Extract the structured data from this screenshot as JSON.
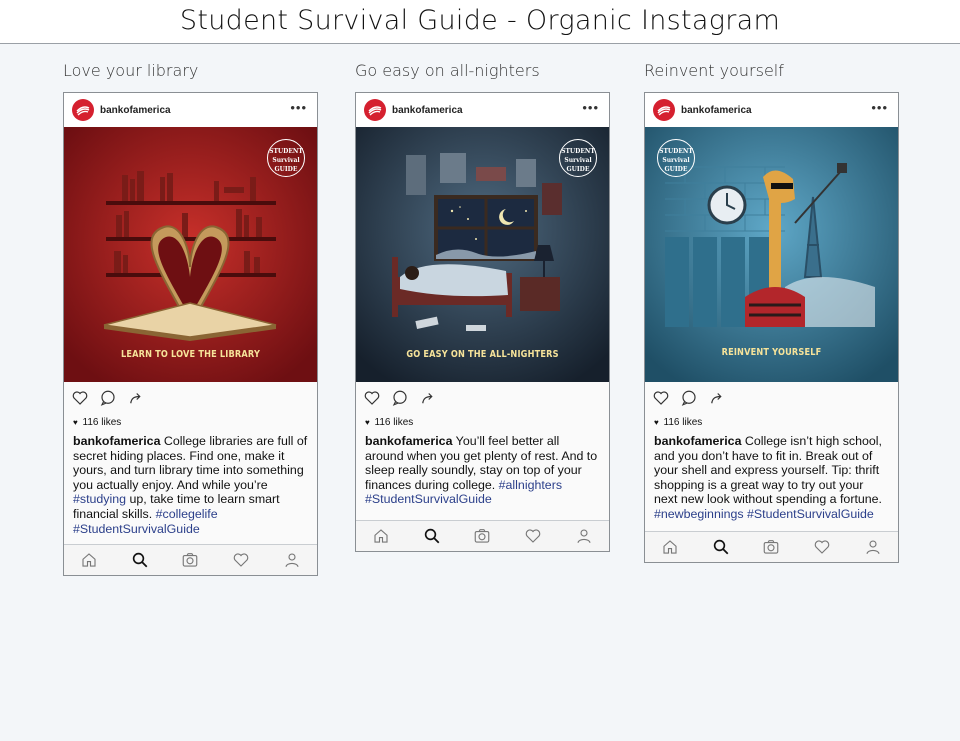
{
  "page": {
    "title": "Student Survival Guide - Organic Instagram"
  },
  "colors": {
    "brand_red": "#d5202f",
    "hashtag": "#2b3f8a",
    "banner_text": "#f6e39a"
  },
  "posts": [
    {
      "label": "Love your library",
      "username": "bankofamerica",
      "banner": "LEARN TO LOVE THE LIBRARY",
      "badge": "STUDENT Survival GUIDE",
      "likes": "116 likes",
      "caption_user": "bankofamerica",
      "caption_parts": [
        " College libraries are full of secret hiding places. Find one, make it yours, and turn library time into something you actually enjoy. And while you’re ",
        "#studying",
        " up, take time to learn smart financial skills. ",
        "#collegelife",
        " ",
        "#StudentSurvivalGuide"
      ]
    },
    {
      "label": "Go easy on all-nighters",
      "username": "bankofamerica",
      "banner": "GO EASY ON THE ALL-NIGHTERS",
      "badge": "STUDENT Survival GUIDE",
      "likes": "116 likes",
      "caption_user": "bankofamerica",
      "caption_parts": [
        " You’ll feel better all around when you get plenty of rest. And to sleep really soundly, stay on top of your finances during college. ",
        "#allnighters",
        " ",
        "#StudentSurvivalGuide"
      ]
    },
    {
      "label": "Reinvent yourself",
      "username": "bankofamerica",
      "banner": "REINVENT YOURSELF",
      "badge": "STUDENT Survival GUIDE",
      "likes": "116 likes",
      "caption_user": "bankofamerica",
      "caption_parts": [
        " College isn’t high school, and you don’t have to fit in. Break out of your shell and express yourself. Tip: thrift shopping is a great way to try out your next new look without spending a fortune. ",
        "#newbeginnings",
        " ",
        "#StudentSurvivalGuide"
      ]
    }
  ],
  "icons": {
    "actions": [
      "heart-icon",
      "comment-icon",
      "share-icon"
    ],
    "nav": [
      "home-icon",
      "search-icon",
      "camera-icon",
      "heart-icon",
      "profile-icon"
    ]
  }
}
